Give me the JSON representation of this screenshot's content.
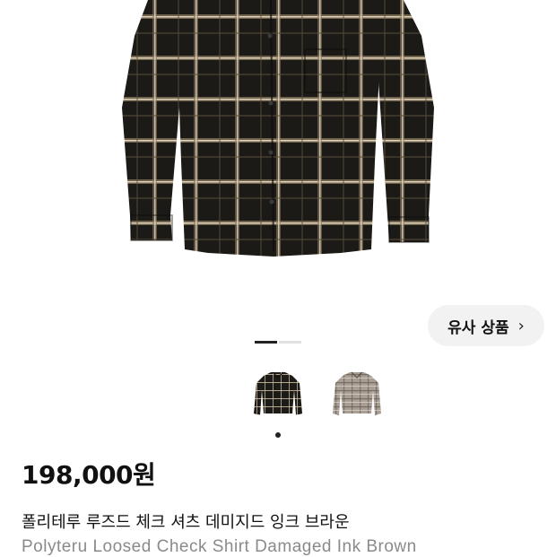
{
  "hero": {
    "image": "dark-check-shirt-photo"
  },
  "similar_button": {
    "label": "유사 상품",
    "chevron": "›"
  },
  "gallery": {
    "slides": 2,
    "active_slide": 1
  },
  "thumbnails": [
    {
      "name": "dark-ink-brown-check-shirt",
      "selected": true
    },
    {
      "name": "light-grey-check-shirt",
      "selected": false
    }
  ],
  "product": {
    "price": "198,000원",
    "name_ko": "폴리테루 루즈드 체크 셔츠 데미지드 잉크 브라운",
    "name_en": "Polyteru Loosed Check Shirt Damaged Ink Brown"
  }
}
